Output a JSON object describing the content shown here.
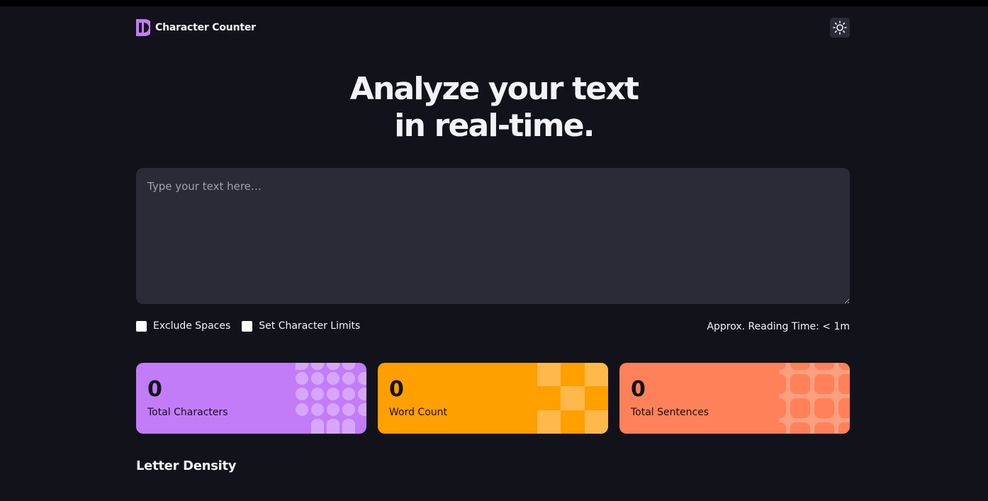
{
  "header": {
    "app_name": "Character Counter",
    "theme_toggle_icon": "sun-icon"
  },
  "hero": {
    "line1": "Analyze your text",
    "line2": "in real-time."
  },
  "input": {
    "placeholder": "Type your text here…",
    "value": ""
  },
  "options": {
    "exclude_spaces_label": "Exclude Spaces",
    "exclude_spaces_checked": false,
    "char_limit_label": "Set Character Limits",
    "char_limit_checked": false,
    "reading_time": "Approx. Reading Time: < 1m"
  },
  "stats": [
    {
      "value": "0",
      "label": "Total Characters",
      "color": "#c27cf8"
    },
    {
      "value": "0",
      "label": "Word Count",
      "color": "#ff9f00"
    },
    {
      "value": "0",
      "label": "Total Sentences",
      "color": "#fe8159"
    }
  ],
  "density": {
    "title": "Letter Density"
  },
  "colors": {
    "background": "#12131a",
    "surface": "#2a2b37",
    "accent_purple": "#c27cf8",
    "accent_orange": "#ff9f00",
    "accent_coral": "#fe8159"
  }
}
